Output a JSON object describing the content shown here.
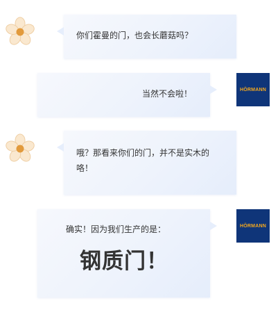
{
  "chat": {
    "messages": [
      {
        "sender": "flower-avatar",
        "text": "你们霍曼的门，也会长蘑菇吗？"
      },
      {
        "sender": "hormann-logo",
        "text": "当然不会啦！"
      },
      {
        "sender": "flower-avatar",
        "text": "哦？那看来你们的门，并不是实木的咯！"
      },
      {
        "sender": "hormann-logo",
        "text": "确实！因为我们生产的是：",
        "emphasis": "钢质门！"
      }
    ]
  },
  "logo": {
    "text": "HÖRMANN"
  },
  "colors": {
    "bubble": "#eef3fc",
    "logo_background": "#0f3579",
    "logo_text": "#f4a81d",
    "flower_petal": "#fae8cf",
    "flower_center": "#e29a3c"
  },
  "icons": {
    "left_avatar": "flower-icon",
    "right_avatar": "hormann-logo"
  }
}
